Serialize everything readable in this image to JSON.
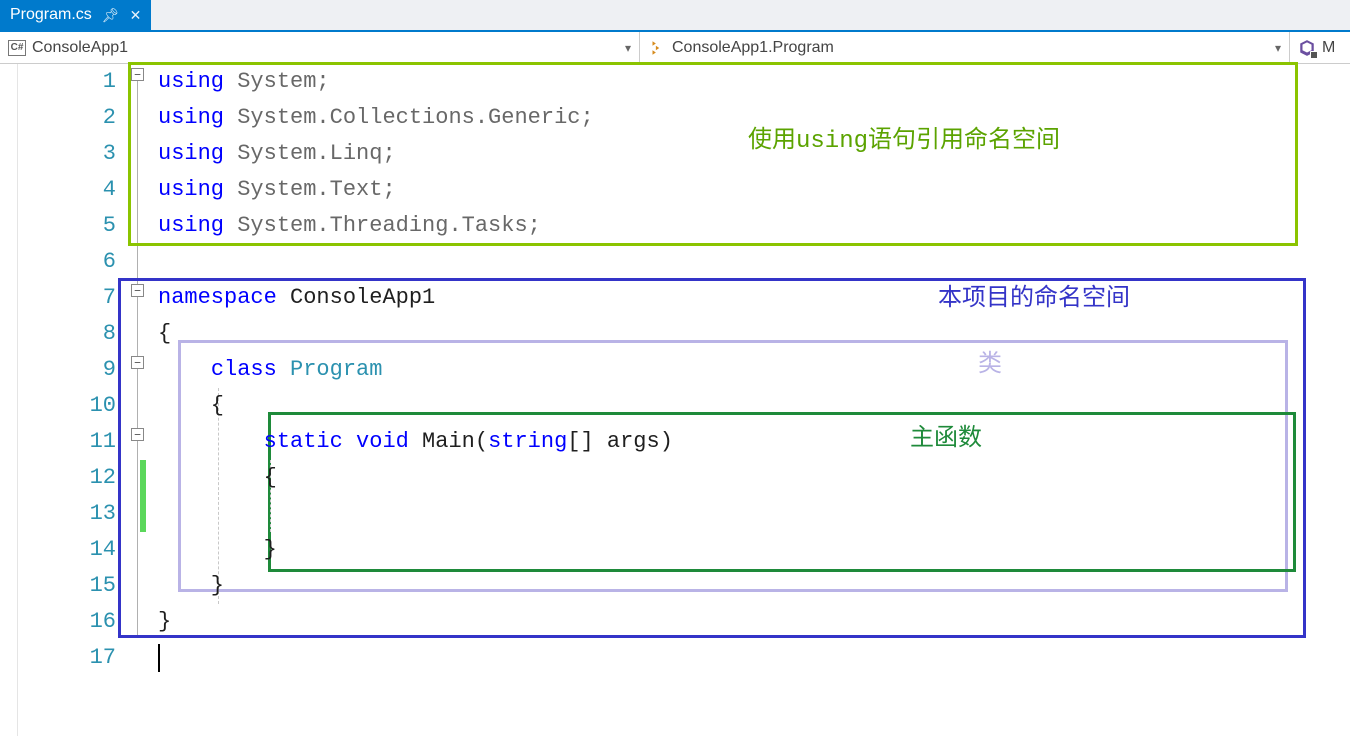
{
  "tab": {
    "title": "Program.cs"
  },
  "nav": {
    "project": "ConsoleApp1",
    "klass": "ConsoleApp1.Program",
    "member": "M"
  },
  "lineNumbers": [
    "1",
    "2",
    "3",
    "4",
    "5",
    "6",
    "7",
    "8",
    "9",
    "10",
    "11",
    "12",
    "13",
    "14",
    "15",
    "16",
    "17"
  ],
  "code": {
    "l1": {
      "kw": "using",
      "rest": " System;"
    },
    "l2": {
      "kw": "using",
      "rest": " System.Collections.Generic;"
    },
    "l3": {
      "kw": "using",
      "rest": " System.Linq;"
    },
    "l4": {
      "kw": "using",
      "rest": " System.Text;"
    },
    "l5": {
      "kw": "using",
      "rest": " System.Threading.Tasks;"
    },
    "l7": {
      "kw": "namespace",
      "rest": " ConsoleApp1"
    },
    "l8": "{",
    "l9": {
      "indent": "    ",
      "kw": "class",
      "sp": " ",
      "type": "Program"
    },
    "l10": "    {",
    "l11": {
      "indent": "        ",
      "kw1": "static",
      "sp1": " ",
      "kw2": "void",
      "rest1": " Main(",
      "kw3": "string",
      "rest2": "[] args)"
    },
    "l12": "        {",
    "l14": "        }",
    "l15": "    }",
    "l16": "}"
  },
  "annotations": {
    "using": "使用using语句引用命名空间",
    "namespace": "本项目的命名空间",
    "klass": "类",
    "main": "主函数"
  }
}
